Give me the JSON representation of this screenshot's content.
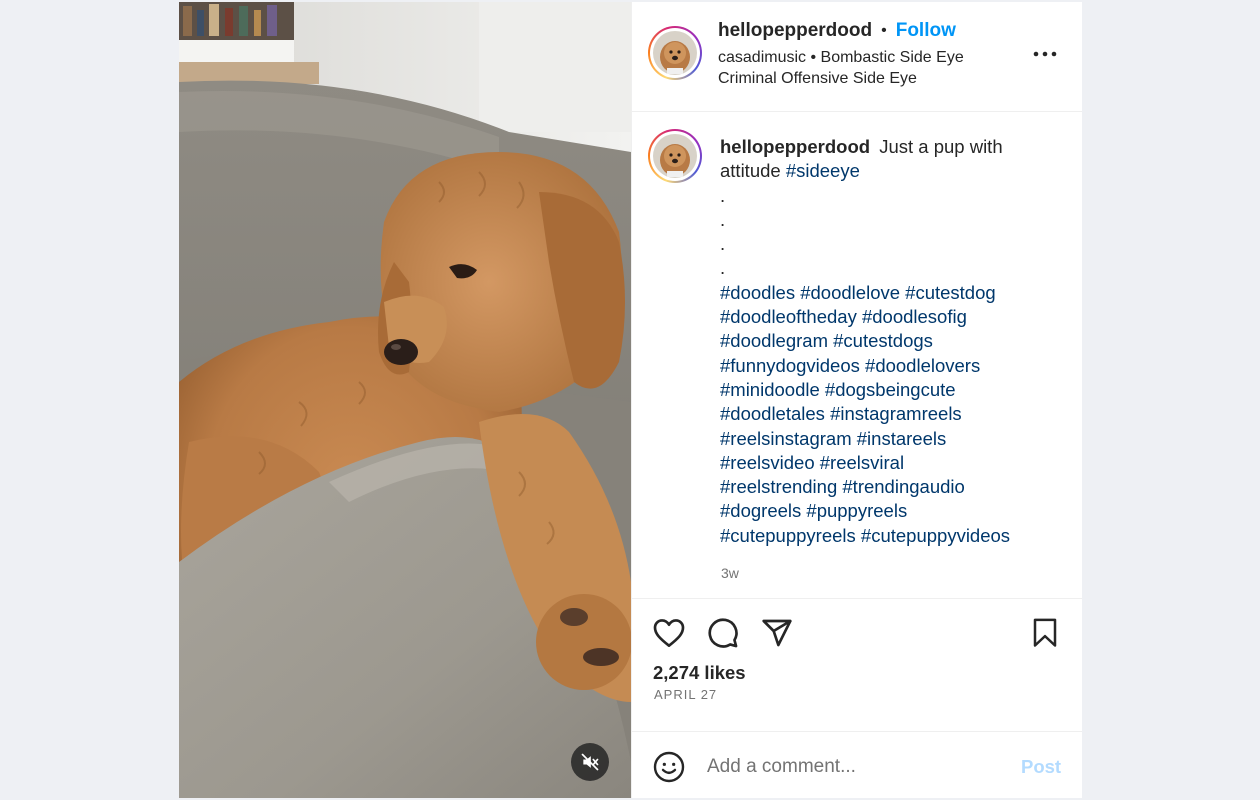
{
  "post": {
    "username": "hellopepperdood",
    "follow_label": "Follow",
    "audio": {
      "artist": "casadimusic",
      "track": "Bombastic Side Eye Criminal Offensive Side Eye"
    },
    "caption": {
      "username": "hellopepperdood",
      "text": "Just a pup with attitude",
      "first_tag": "#sideeye",
      "spacer_lines": [
        ".",
        ".",
        ".",
        "."
      ],
      "hashtag_lines": [
        [
          "#doodles",
          "#doodlelove",
          "#cutestdog"
        ],
        [
          "#doodleoftheday",
          "#doodlesofig"
        ],
        [
          "#doodlegram",
          "#cutestdogs"
        ],
        [
          "#funnydogvideos",
          "#doodlelovers"
        ],
        [
          "#minidoodle",
          "#dogsbeingcute"
        ],
        [
          "#doodletales",
          "#instagramreels"
        ],
        [
          "#reelsinstagram",
          "#instareels"
        ],
        [
          "#reelsvideo",
          "#reelsviral"
        ],
        [
          "#reelstrending",
          "#trendingaudio"
        ],
        [
          "#dogreels",
          "#puppyreels"
        ],
        [
          "#cutepuppyreels",
          "#cutepuppyvideos"
        ]
      ]
    },
    "time_ago": "3w",
    "likes": "2,274 likes",
    "date": "APRIL 27"
  },
  "comment_box": {
    "placeholder": "Add a comment...",
    "post_label": "Post"
  },
  "icons": {
    "more": "more-horizontal-icon",
    "like": "heart-icon",
    "comment": "comment-icon",
    "share": "paper-plane-icon",
    "save": "bookmark-icon",
    "emoji": "smiley-icon",
    "mute": "speaker-muted-icon"
  },
  "colors": {
    "follow": "#0095f6",
    "hashtag": "#00376b",
    "post_disabled": "#b3dbff",
    "secondary_text": "#737373"
  }
}
